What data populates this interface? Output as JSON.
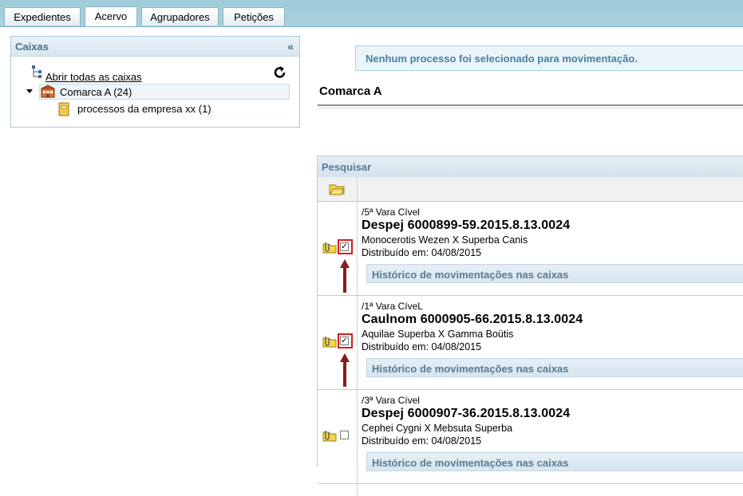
{
  "tabs": [
    {
      "label": "Expedientes",
      "active": false
    },
    {
      "label": "Acervo",
      "active": true
    },
    {
      "label": "Agrupadores",
      "active": false
    },
    {
      "label": "Petições",
      "active": false
    }
  ],
  "caixas": {
    "title": "Caixas",
    "collapse": "«",
    "open_all": "Abrir todas as caixas",
    "node": "Comarca A (24)",
    "child": "processos da empresa xx (1)"
  },
  "notice": "Nenhum processo foi selecionado para movimentação.",
  "comarca_title": "Comarca A",
  "search_label": "Pesquisar",
  "history_label": "Histórico de movimentações nas caixas",
  "rows": [
    {
      "vara": "/5ª Vara Cível",
      "processo": "Despej 6000899-59.2015.8.13.0024",
      "partes": "Monocerotis Wezen X Superba Canis",
      "distribuido": "Distribuído em: 04/08/2015",
      "checked": true
    },
    {
      "vara": "/1ª Vara CíveL",
      "processo": "Caulnom 6000905-66.2015.8.13.0024",
      "partes": "Aquilae Superba X Gamma Boütis",
      "distribuido": "Distribuído em: 04/08/2015",
      "checked": true
    },
    {
      "vara": "/3ª Vara Cível",
      "processo": "Despej 6000907-36.2015.8.13.0024",
      "partes": "Cephei Cygni X Mebsuta Superba",
      "distribuido": "Distribuído em: 04/08/2015",
      "checked": false
    }
  ],
  "colors": {
    "tabbar": "#a3cddb",
    "panel_title": "#4d6f8c",
    "notice_text": "#4a80a3",
    "highlight": "#d91c1c",
    "arrow": "#8b1a1a"
  }
}
